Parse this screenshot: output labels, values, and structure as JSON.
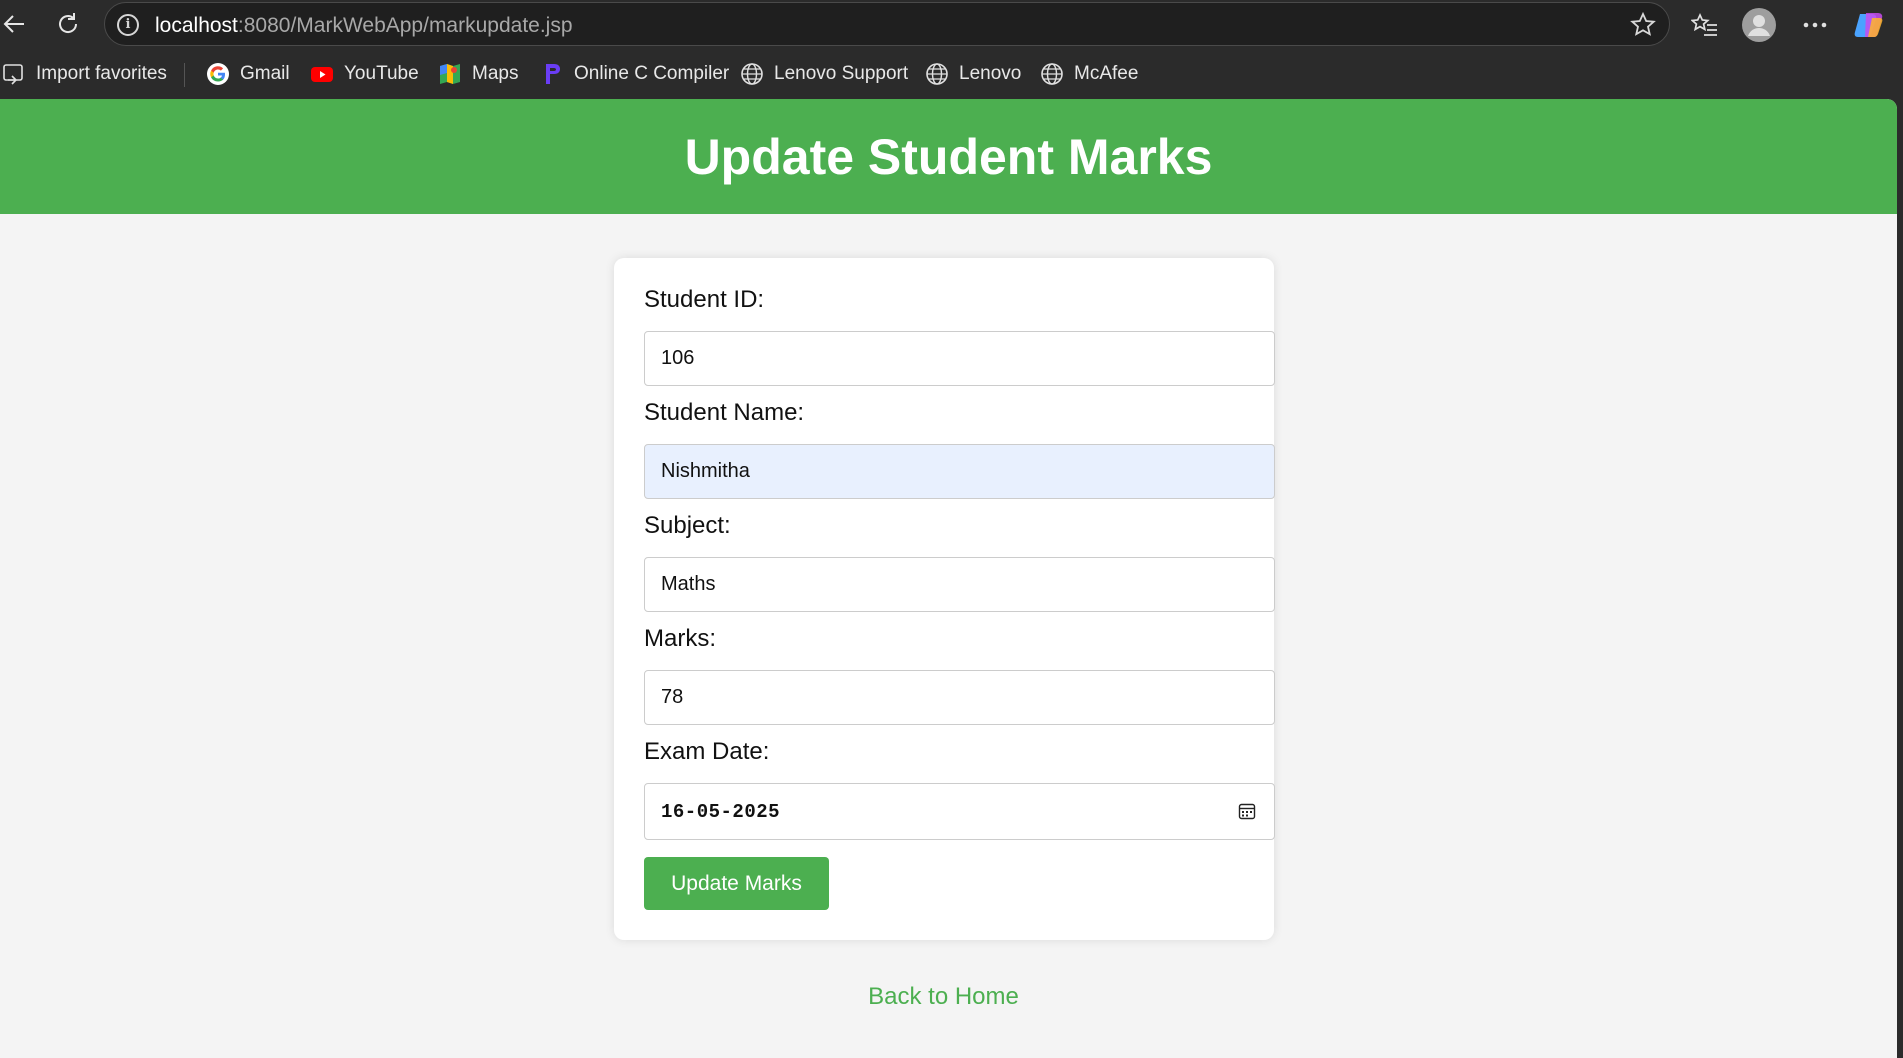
{
  "browser": {
    "url_host": "localhost",
    "url_rest": ":8080/MarkWebApp/markupdate.jsp",
    "favorites": [
      {
        "label": "Import favorites",
        "icon": "import-icon"
      },
      {
        "label": "Gmail",
        "icon": "google-icon"
      },
      {
        "label": "YouTube",
        "icon": "youtube-icon"
      },
      {
        "label": "Maps",
        "icon": "maps-icon"
      },
      {
        "label": "Online C Compiler",
        "icon": "compiler-icon"
      },
      {
        "label": "Lenovo Support",
        "icon": "globe-icon"
      },
      {
        "label": "Lenovo",
        "icon": "globe-icon"
      },
      {
        "label": "McAfee",
        "icon": "globe-icon"
      }
    ]
  },
  "page": {
    "title": "Update Student Marks",
    "accent_color": "#4caf50",
    "form": {
      "student_id_label": "Student ID:",
      "student_id_value": "106",
      "student_name_label": "Student Name:",
      "student_name_value": "Nishmitha",
      "subject_label": "Subject:",
      "subject_value": "Maths",
      "marks_label": "Marks:",
      "marks_value": "78",
      "exam_date_label": "Exam Date:",
      "exam_date_value": "16-05-2025",
      "submit_label": "Update Marks"
    },
    "back_link": "Back to Home"
  }
}
